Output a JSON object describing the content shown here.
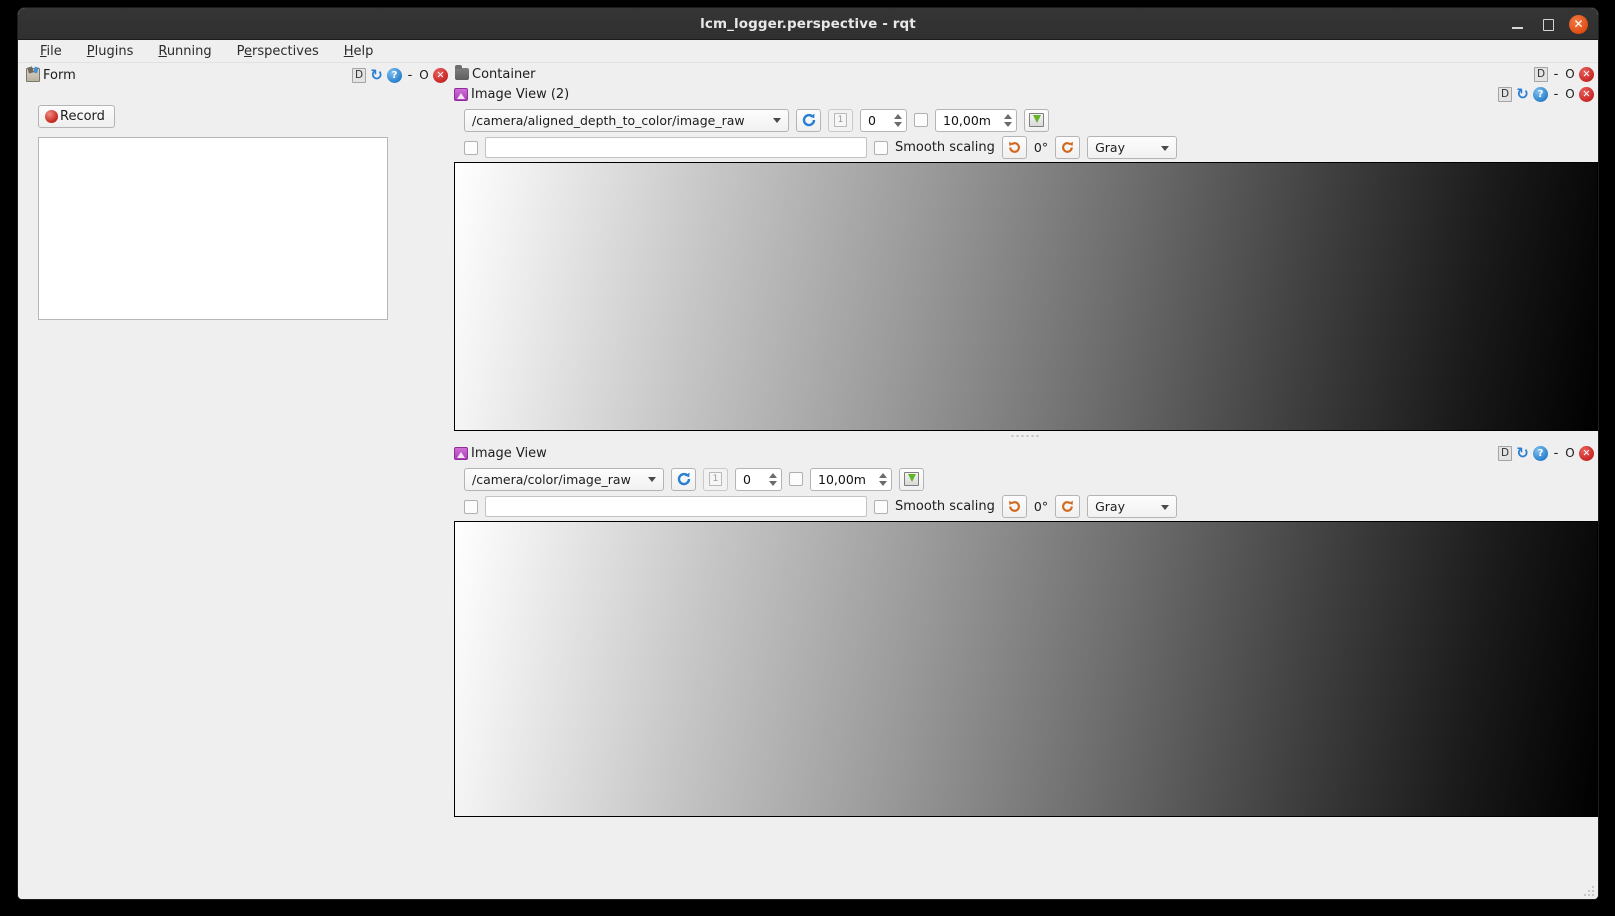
{
  "window": {
    "title": "lcm_logger.perspective - rqt",
    "buttons": {
      "minimize": "–",
      "maximize": "□",
      "close": "✕"
    }
  },
  "menubar": {
    "items": [
      {
        "pre": "",
        "mnemonic": "F",
        "post": "ile",
        "label": "File"
      },
      {
        "pre": "",
        "mnemonic": "P",
        "post": "lugins",
        "label": "Plugins"
      },
      {
        "pre": "",
        "mnemonic": "R",
        "post": "unning",
        "label": "Running"
      },
      {
        "pre": "P",
        "mnemonic": "e",
        "post": "rspectives",
        "label": "Perspectives"
      },
      {
        "pre": "",
        "mnemonic": "H",
        "post": "elp",
        "label": "Help"
      }
    ]
  },
  "dock_controls": {
    "dock": "D",
    "reload": "↻",
    "help": "?",
    "minimize": "-",
    "maximize": "O",
    "close": "✕"
  },
  "form_panel": {
    "title": "Form",
    "icon": "form-icon",
    "record_button": "Record",
    "list_items": []
  },
  "container_panel": {
    "title": "Container",
    "icon": "folder-icon"
  },
  "image_view_2": {
    "title": "Image View (2)",
    "icon": "image-icon",
    "topic": "/camera/aligned_depth_to_color/image_raw",
    "refresh_icon": "refresh-icon",
    "index_button": "1",
    "zoom_value": "0",
    "max_range_checkbox": false,
    "max_range": "10,00m",
    "save_icon": "save-icon",
    "publish_checkbox": false,
    "publish_topic": "",
    "smooth_scaling_label": "Smooth scaling",
    "smooth_scaling_checked": false,
    "rotate_ccw_icon": "rotate-ccw-icon",
    "rotation": "0°",
    "rotate_cw_icon": "rotate-cw-icon",
    "colormap": "Gray"
  },
  "image_view_1": {
    "title": "Image View",
    "icon": "image-icon",
    "topic": "/camera/color/image_raw",
    "refresh_icon": "refresh-icon",
    "index_button": "1",
    "zoom_value": "0",
    "max_range_checkbox": false,
    "max_range": "10,00m",
    "save_icon": "save-icon",
    "publish_checkbox": false,
    "publish_topic": "",
    "smooth_scaling_label": "Smooth scaling",
    "smooth_scaling_checked": false,
    "rotate_ccw_icon": "rotate-ccw-icon",
    "rotation": "0°",
    "rotate_cw_icon": "rotate-cw-icon",
    "colormap": "Gray"
  },
  "colors": {
    "chrome": "#efefef",
    "titlebar": "#333333",
    "close_accent": "#e04b12",
    "dock_close": "#c4201e",
    "help_blue": "#2079c8",
    "refresh_blue": "#2a7fd4",
    "rotate_orange": "#d2691e",
    "record_red": "#c11f15",
    "image_icon_purple": "#ab3fb6"
  }
}
